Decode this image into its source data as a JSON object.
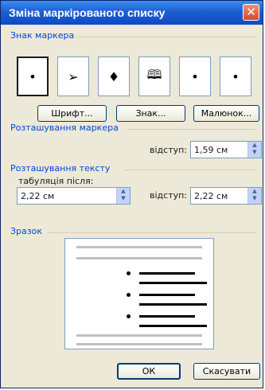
{
  "title": "Зміна маркірованого списку",
  "close_icon": "close-icon",
  "bullet_group": {
    "label": "Знак маркера",
    "items": [
      "•",
      "➢",
      "♦",
      "🕮",
      "•",
      "•"
    ]
  },
  "buttons": {
    "font": "Шрифт...",
    "sign": "Знак...",
    "picture": "Малюнок..."
  },
  "marker_position": {
    "label": "Розташування маркера",
    "indent_label": "відступ:",
    "indent_value": "1,59 см"
  },
  "text_position": {
    "label": "Розташування тексту",
    "tab_label": "табуляція після:",
    "tab_value": "2,22 см",
    "indent_label": "відступ:",
    "indent_value": "2,22 см"
  },
  "sample": {
    "label": "Зразок"
  },
  "dialog": {
    "ok": "ОК",
    "cancel": "Скасувати"
  }
}
